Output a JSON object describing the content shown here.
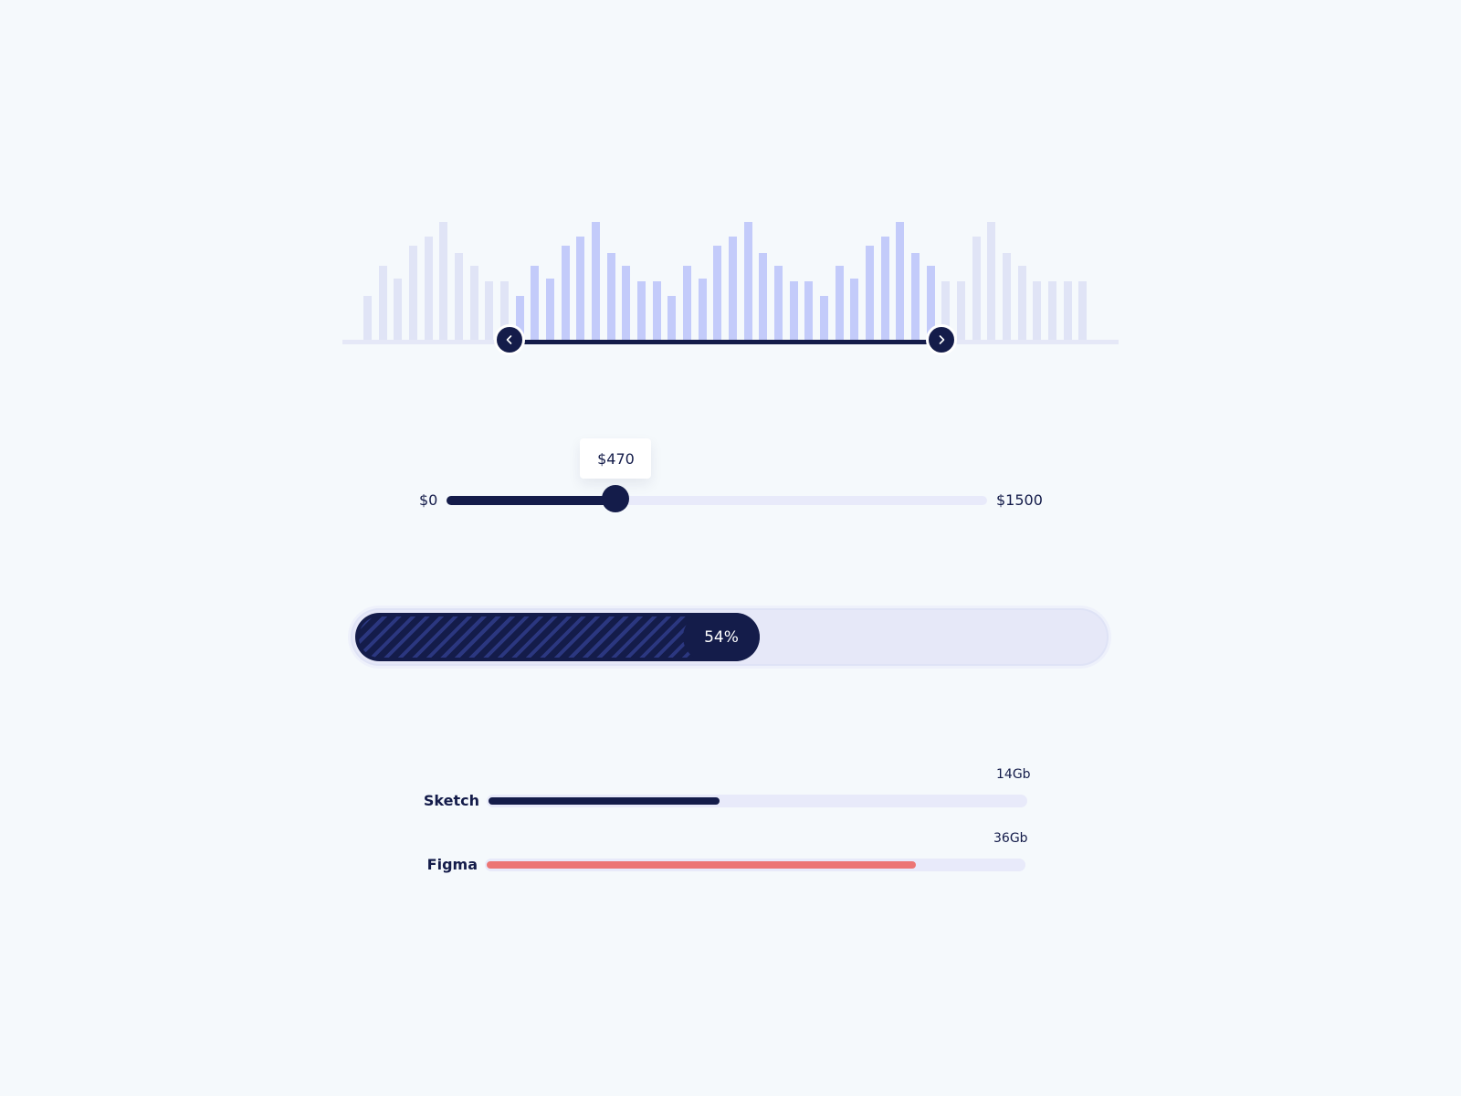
{
  "histogram_range": {
    "bar_levels": [
      0.38,
      0.63,
      0.52,
      0.8,
      0.88,
      1.0,
      0.74,
      0.63,
      0.5,
      0.5,
      0.38,
      0.63,
      0.52,
      0.8,
      0.88,
      1.0,
      0.74,
      0.63,
      0.5,
      0.5,
      0.38,
      0.63,
      0.52,
      0.8,
      0.88,
      1.0,
      0.74,
      0.63,
      0.5,
      0.5,
      0.38,
      0.63,
      0.52,
      0.8,
      0.88,
      1.0,
      0.74,
      0.63,
      0.5,
      0.5,
      0.88,
      1.0,
      0.74,
      0.63,
      0.5,
      0.5,
      0.5,
      0.5
    ],
    "selected_start": 0.2,
    "selected_end": 0.78,
    "icons": {
      "left": "chevron-left-icon",
      "right": "chevron-right-icon"
    },
    "colors": {
      "bar_selected": "#c3cbfa",
      "bar_unselected": "#e0e4f6"
    }
  },
  "price_slider": {
    "min_label": "$0",
    "max_label": "$1500",
    "value_label": "$470",
    "min": 0,
    "max": 1500,
    "value": 470
  },
  "progress": {
    "value": 54,
    "label": "54%"
  },
  "storage": [
    {
      "name": "Sketch",
      "size_label": "14Gb",
      "fraction": 0.43,
      "color": "#141c4a"
    },
    {
      "name": "Figma",
      "size_label": "36Gb",
      "fraction": 0.8,
      "color": "#ec7574"
    }
  ],
  "colors": {
    "navy": "#141c4a",
    "background": "#f5f9fc",
    "track": "#e8eafa"
  }
}
